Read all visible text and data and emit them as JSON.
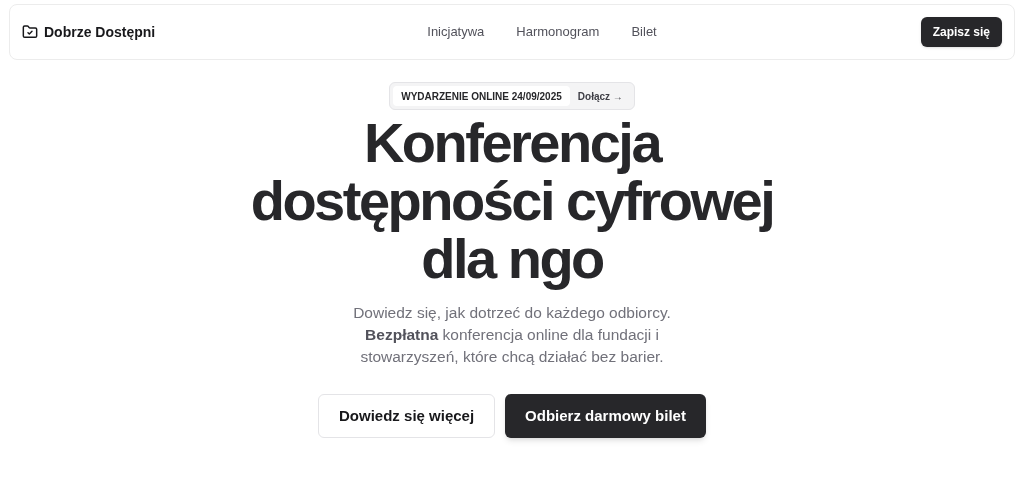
{
  "nav": {
    "brand": "Dobrze Dostępni",
    "links": [
      "Inicjatywa",
      "Harmonogram",
      "Bilet"
    ],
    "cta": "Zapisz się"
  },
  "badge": {
    "label": "WYDARZENIE ONLINE 24/09/2025",
    "link": "Dołącz →"
  },
  "hero": {
    "title": "Konferencja dostępności cyfrowej dla ngo",
    "description": "Dowiedz się, jak dotrzeć do każdego odbiorcy. **Bezpłatna** konferencja online dla fundacji i stowarzyszeń, które chcą działać bez barier."
  },
  "buttons": [
    {
      "label": "Dowiedz się więcej",
      "kind": "outline"
    },
    {
      "label": "Odbierz darmowy bilet",
      "kind": "primary"
    }
  ]
}
